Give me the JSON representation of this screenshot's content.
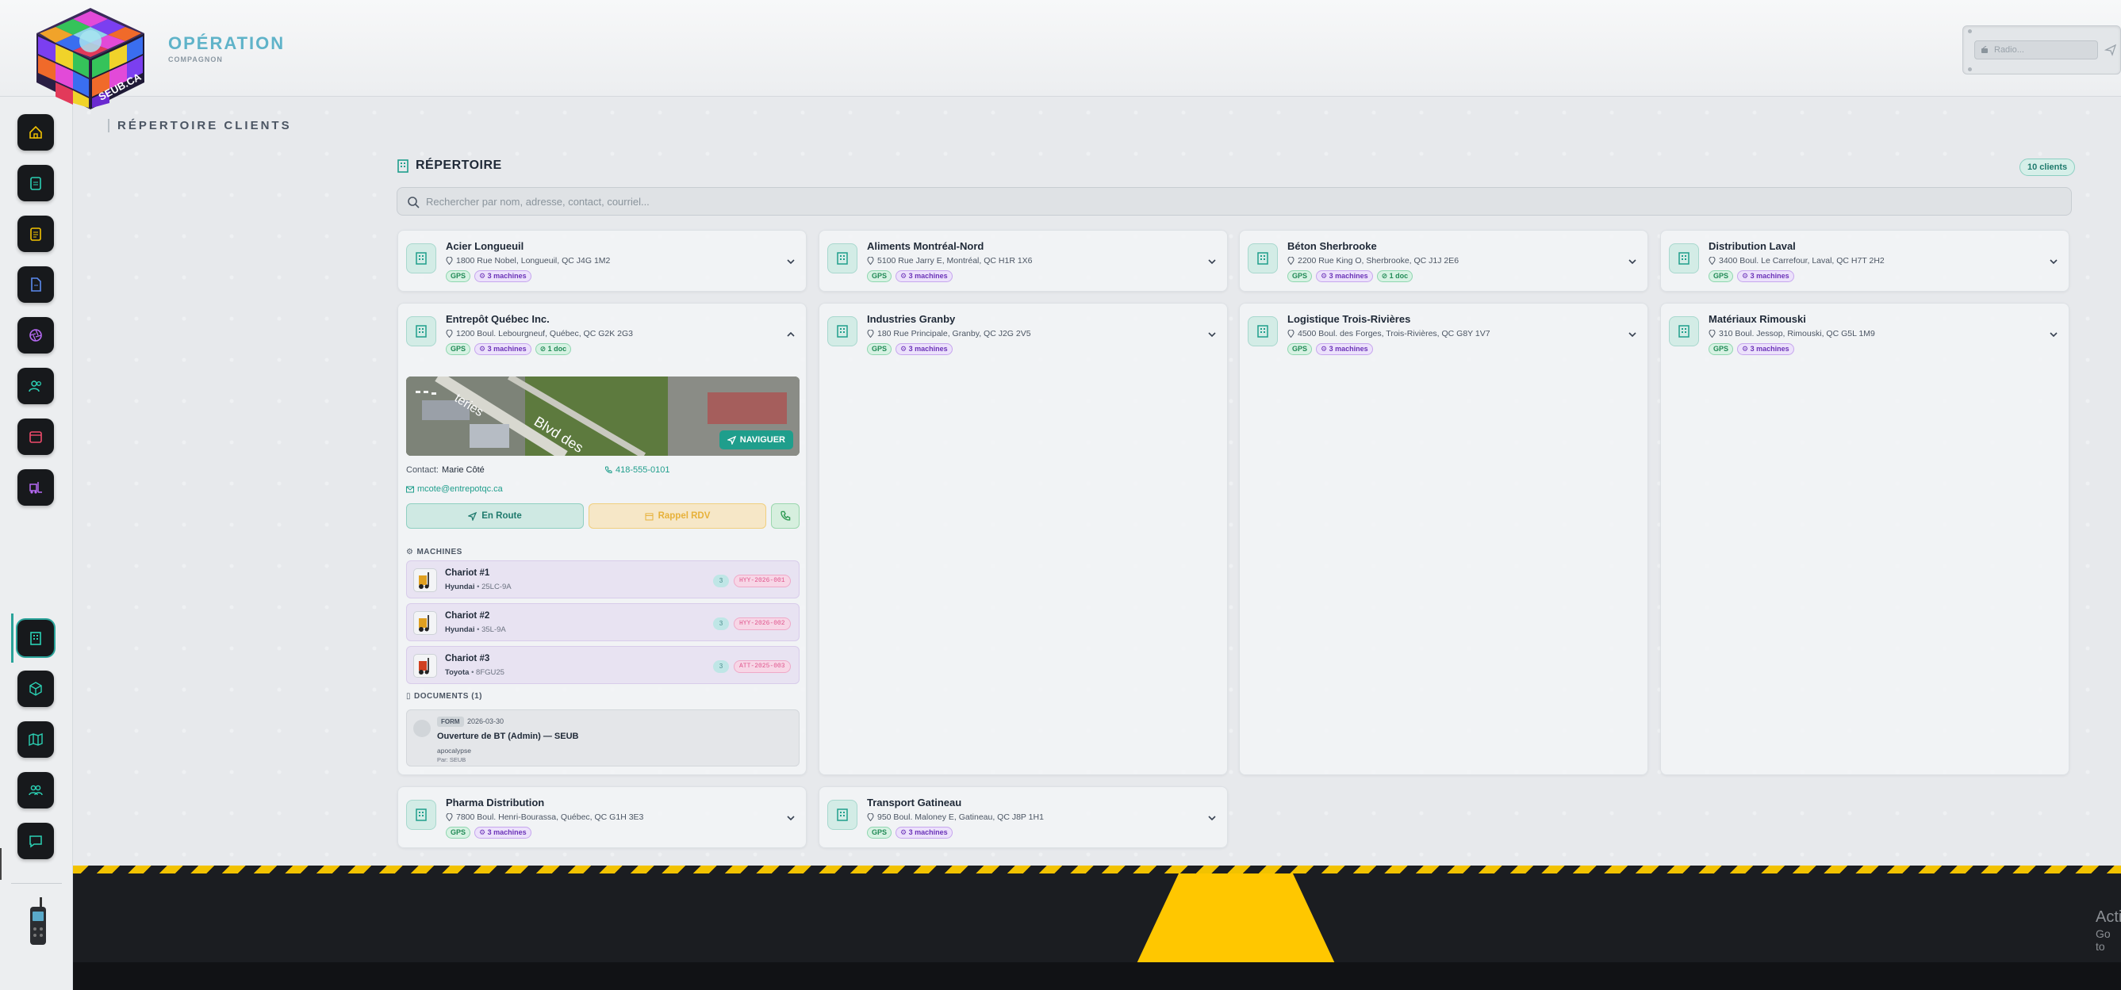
{
  "brand": {
    "title": "OPÉRATION",
    "subtitle": "COMPAGNON",
    "logo_text": "SEUB.CA"
  },
  "radio": {
    "placeholder": "Radio..."
  },
  "sidebar": {
    "items": [
      {
        "icon": "home-icon",
        "color": "#f2c200"
      },
      {
        "icon": "clipboard-icon",
        "color": "#2bd1b4"
      },
      {
        "icon": "clipboard-list-icon",
        "color": "#f2c200"
      },
      {
        "icon": "document-icon",
        "color": "#5b8bf0"
      },
      {
        "icon": "aperture-icon",
        "color": "#b76af5"
      },
      {
        "icon": "users-icon",
        "color": "#2bd1b4"
      },
      {
        "icon": "calendar-icon",
        "color": "#f04a6b"
      },
      {
        "icon": "forklift-icon",
        "color": "#b76af5"
      },
      {
        "icon": "building-icon",
        "color": "#2bd1b4",
        "active": true
      },
      {
        "icon": "cube-icon",
        "color": "#2bd1b4"
      },
      {
        "icon": "map-icon",
        "color": "#2bd1b4"
      },
      {
        "icon": "team-icon",
        "color": "#2bd1b4"
      },
      {
        "icon": "chat-icon",
        "color": "#2bd1b4"
      }
    ]
  },
  "page": {
    "label": "RÉPERTOIRE CLIENTS",
    "section_title": "RÉPERTOIRE",
    "count": "10 clients",
    "search_placeholder": "Rechercher par nom, adresse, contact, courriel..."
  },
  "clients": [
    {
      "name": "Acier Longueuil",
      "address": "1800 Rue Nobel, Longueuil, QC J4G 1M2",
      "gps": "GPS",
      "machines": "3 machines"
    },
    {
      "name": "Aliments Montréal-Nord",
      "address": "5100 Rue Jarry E, Montréal, QC H1R 1X6",
      "gps": "GPS",
      "machines": "3 machines"
    },
    {
      "name": "Béton Sherbrooke",
      "address": "2200 Rue King O, Sherbrooke, QC J1J 2E6",
      "gps": "GPS",
      "machines": "3 machines",
      "docs": "1 doc"
    },
    {
      "name": "Distribution Laval",
      "address": "3400 Boul. Le Carrefour, Laval, QC H7T 2H2",
      "gps": "GPS",
      "machines": "3 machines"
    },
    {
      "name": "Entrepôt Québec Inc.",
      "address": "1200 Boul. Lebourgneuf, Québec, QC G2K 2G3",
      "gps": "GPS",
      "machines": "3 machines",
      "docs": "1 doc"
    },
    {
      "name": "Industries Granby",
      "address": "180 Rue Principale, Granby, QC J2G 2V5",
      "gps": "GPS",
      "machines": "3 machines"
    },
    {
      "name": "Logistique Trois-Rivières",
      "address": "4500 Boul. des Forges, Trois-Rivières, QC G8Y 1V7",
      "gps": "GPS",
      "machines": "3 machines"
    },
    {
      "name": "Matériaux Rimouski",
      "address": "310 Boul. Jessop, Rimouski, QC G5L 1M9",
      "gps": "GPS",
      "machines": "3 machines"
    },
    {
      "name": "Pharma Distribution",
      "address": "7800 Boul. Henri-Bourassa, Québec, QC G1H 3E3",
      "gps": "GPS",
      "machines": "3 machines"
    },
    {
      "name": "Transport Gatineau",
      "address": "950 Boul. Maloney E, Gatineau, QC J8P 1H1",
      "gps": "GPS",
      "machines": "3 machines"
    }
  ],
  "expanded": {
    "map_labels": [
      "teries",
      "Blvd des"
    ],
    "navigate": "NAVIGUER",
    "contact_label": "Contact:",
    "contact_name": "Marie Côté",
    "phone": "418-555-0101",
    "email": "mcote@entrepotqc.ca",
    "btn_route": "En Route",
    "btn_rdv": "Rappel RDV",
    "machines_title": "MACHINES",
    "machines": [
      {
        "name": "Chariot #1",
        "brand": "Hyundai",
        "model": "• 25LC-9A",
        "count": "3",
        "id": "HYY-2026-001"
      },
      {
        "name": "Chariot #2",
        "brand": "Hyundai",
        "model": "• 35L-9A",
        "count": "3",
        "id": "HYY-2026-002"
      },
      {
        "name": "Chariot #3",
        "brand": "Toyota",
        "model": "• 8FGU25",
        "count": "3",
        "id": "ATT-2025-003"
      }
    ],
    "documents_title": "DOCUMENTS (1)",
    "document": {
      "tag": "FORM",
      "date": "2026-03-30",
      "title": "Ouverture de BT (Admin) — SEUB",
      "desc": "apocalypse",
      "by": "Par: SEUB"
    }
  },
  "footer": {
    "activate_title": "Acti",
    "activate_sub": "Go to"
  }
}
